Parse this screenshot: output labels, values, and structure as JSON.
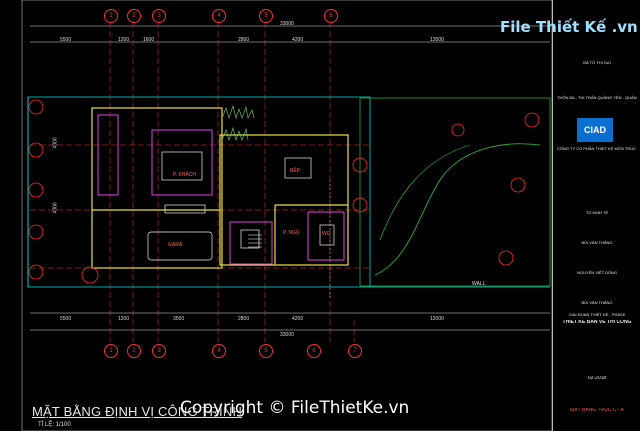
{
  "grid_top": [
    "1",
    "2",
    "3",
    "4",
    "5",
    "6"
  ],
  "grid_bottom": [
    "1",
    "2",
    "3",
    "4",
    "5",
    "6",
    "7"
  ],
  "left_axis": [
    "A",
    "B",
    "C",
    "D"
  ],
  "dims_top": [
    "5500",
    "1200",
    "1600",
    "2800",
    "4200",
    "13500"
  ],
  "dim_top_total": "33000",
  "dims_bottom": [
    "5500",
    "1200",
    "3500",
    "2800",
    "4200",
    "12000"
  ],
  "dim_bottom_total": "33000",
  "side_dims": [
    "4300",
    "4300",
    "4300"
  ],
  "rooms": {
    "bedroom": "P. KHÁCH",
    "dining": "BẾP",
    "garage": "GARA",
    "wc": "P. NGỦ",
    "wc2": "WC"
  },
  "wall_label": "WALL",
  "drawing_title": "MẶT BẰNG ĐỊNH VỊ CÔNG TRÌNH",
  "drawing_scale": "TỈ LỆ: 1/100",
  "watermark_logo": "File Thiết Kế .vn",
  "watermark_footer": "Copyright © FileThietKe.vn",
  "title_block": {
    "client": "BÀ TÔ THỊ GAI",
    "location": "THÔN BA - THỊ TRẤN QUẢNG YÊN - QUẢNG NINH",
    "company_logo": "CIAD",
    "company": "CÔNG TY CỔ PHẦN THIẾT KẾ KIẾN TRÚC ĐÔ THỊ",
    "roles": [
      "TỔ KINH TẾ",
      "BÙI VĂN THẮNG",
      "NGUYỄN VIỆT DŨNG",
      "BÙI VĂN THẮNG"
    ],
    "phase": "GIAI ĐOẠN THIẾT KẾ - PHASE",
    "phase_value": "THIẾT KẾ BẢN VẼ THI CÔNG",
    "code": "02-2018",
    "sheet": "MẶT BẰNG TRỤC C - A"
  }
}
